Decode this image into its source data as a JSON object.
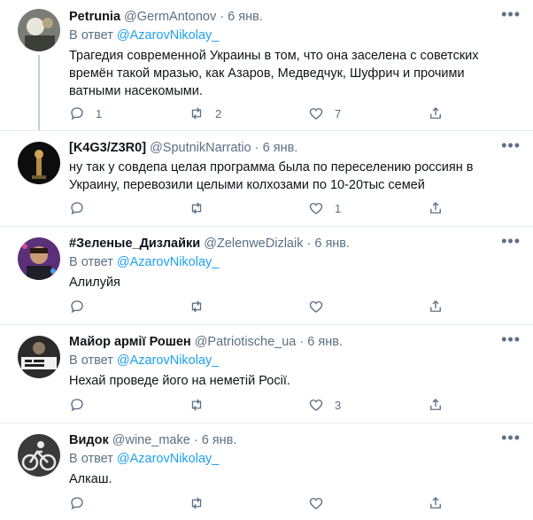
{
  "tweets": [
    {
      "name": "Petrunia",
      "handle": "@GermAntonov",
      "dot": "·",
      "time": "6 янв.",
      "reply_prefix": "В ответ",
      "reply_to": "@AzarovNikolay_",
      "text": "Трагедия современной Украины в том, что она заселена с советских времён такой мразью, как Азаров, Медведчук, Шуфрич и прочими ватными насекомыми.",
      "replies": "1",
      "retweets": "2",
      "likes": "7"
    },
    {
      "name": "[K4G3/Z3R0]",
      "handle": "@SputnikNarratio",
      "dot": "·",
      "time": "6 янв.",
      "text": "ну так у совдепа целая программа была по переселению россиян в Украину, перевозили целыми колхозами по 10-20тыс семей",
      "replies": "",
      "retweets": "",
      "likes": "1"
    },
    {
      "name": "#Зеленые_Дизлайки",
      "handle": "@ZelenweDizlaik",
      "dot": "·",
      "time": "6 янв.",
      "reply_prefix": "В ответ",
      "reply_to": "@AzarovNikolay_",
      "text": "Алилуйя",
      "replies": "",
      "retweets": "",
      "likes": ""
    },
    {
      "name": "Майор армії Рошен",
      "handle": "@Patriotische_ua",
      "dot": "·",
      "time": "6 янв.",
      "reply_prefix": "В ответ",
      "reply_to": "@AzarovNikolay_",
      "text": "Нехай проведе його на неметій Росії.",
      "replies": "",
      "retweets": "",
      "likes": "3"
    },
    {
      "name": "Видок",
      "handle": "@wine_make",
      "dot": "·",
      "time": "6 янв.",
      "reply_prefix": "В ответ",
      "reply_to": "@AzarovNikolay_",
      "text": "Алкаш.",
      "replies": "",
      "retweets": "",
      "likes": ""
    }
  ],
  "colors": {
    "accent": "#1da1f2",
    "secondary_text": "#5b7083",
    "divider": "#e6ecf0"
  },
  "icons": [
    "more-icon",
    "reply-icon",
    "retweet-icon",
    "like-icon",
    "share-icon"
  ]
}
